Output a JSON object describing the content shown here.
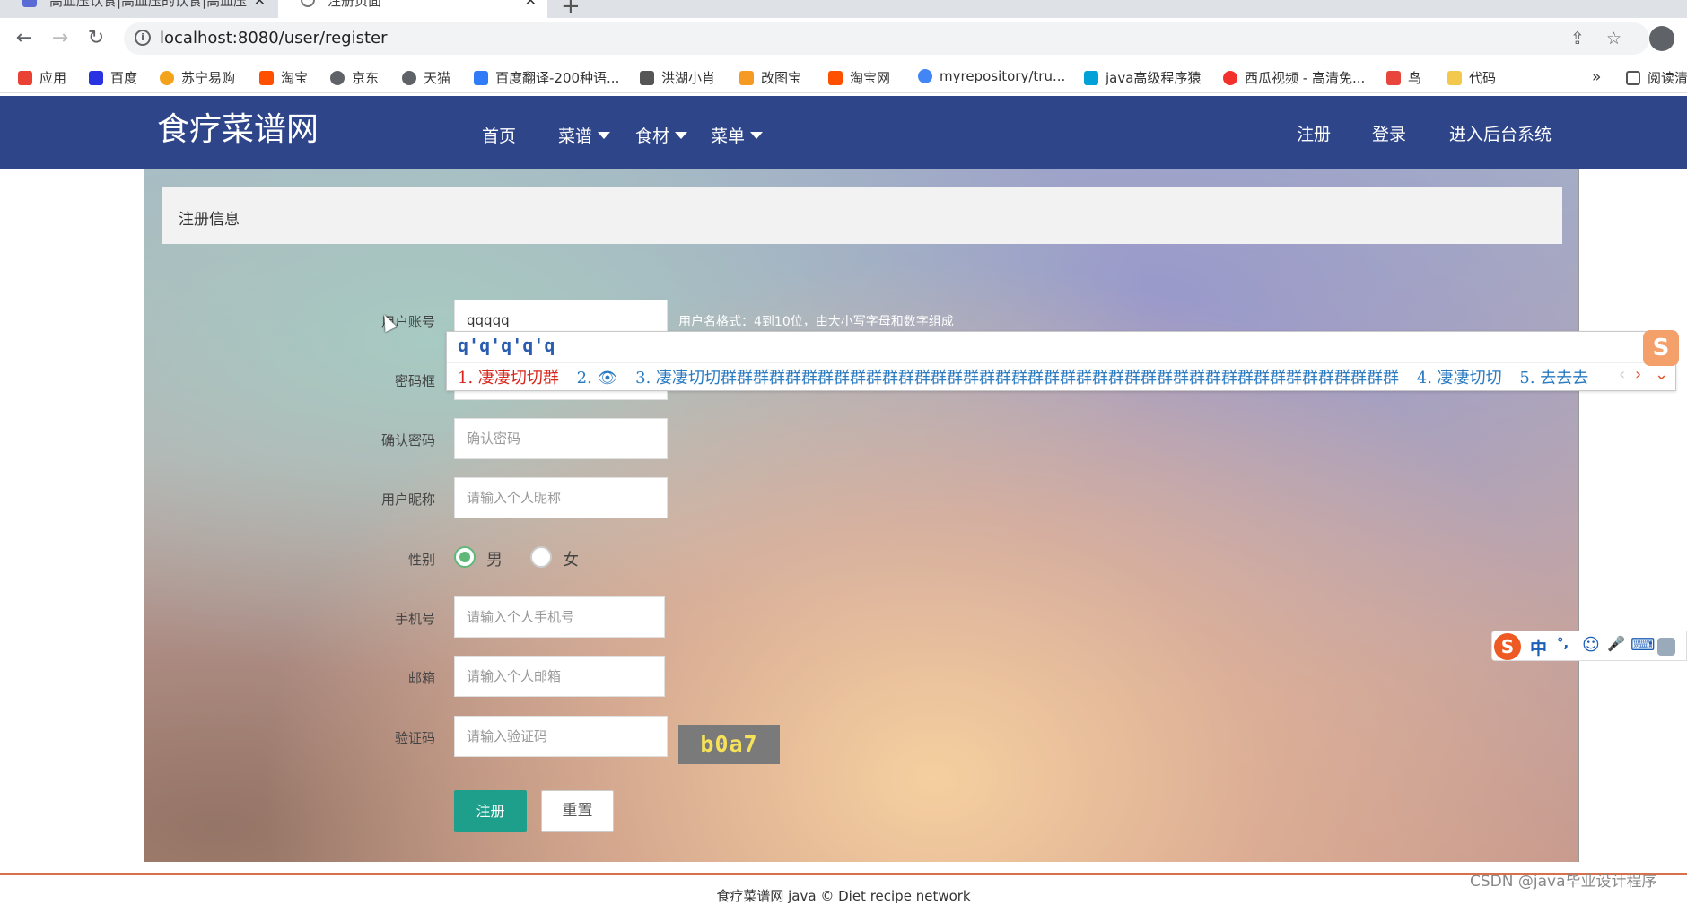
{
  "browser": {
    "tabs": [
      {
        "title": "高血压饮食|高血压的饮食|高血压"
      },
      {
        "title": "注册页面"
      }
    ],
    "url": "localhost:8080/user/register",
    "bookmarks": [
      {
        "label": "应用",
        "color": "#e94235"
      },
      {
        "label": "百度",
        "color": "#2932e1"
      },
      {
        "label": "苏宁易购",
        "color": "#f3a21b"
      },
      {
        "label": "淘宝",
        "color": "#ff5000"
      },
      {
        "label": "京东",
        "color": "#5f6368"
      },
      {
        "label": "天猫",
        "color": "#5f6368"
      },
      {
        "label": "百度翻译-200种语...",
        "color": "#2f7cf6"
      },
      {
        "label": "洪湖小肖",
        "color": "#555555"
      },
      {
        "label": "改图宝",
        "color": "#f59b23"
      },
      {
        "label": "淘宝网",
        "color": "#ff5000"
      },
      {
        "label": "myrepository/tru...",
        "color": "#4285f4"
      },
      {
        "label": "java高级程序猿",
        "color": "#00a1d6"
      },
      {
        "label": "西瓜视频 - 高清免...",
        "color": "#f2312d"
      },
      {
        "label": "鸟",
        "color": "#e8453c"
      },
      {
        "label": "代码",
        "color": "#f2c94c"
      }
    ],
    "bookmarks_more": "»",
    "reading_list": "阅读清"
  },
  "site": {
    "logo": "食疗菜谱网",
    "nav": [
      "首页",
      "菜谱",
      "食材",
      "菜单"
    ],
    "right_nav": [
      "注册",
      "登录",
      "进入后台系统"
    ]
  },
  "form": {
    "panel_title": "注册信息",
    "username": {
      "label": "用户账号",
      "value": "qqqqq",
      "hint": "用户名格式：4到10位，由大小写字母和数字组成"
    },
    "password": {
      "label": "密码框"
    },
    "confirm": {
      "label": "确认密码",
      "placeholder": "确认密码"
    },
    "nickname": {
      "label": "用户昵称",
      "placeholder": "请输入个人昵称"
    },
    "gender": {
      "label": "性别",
      "options": [
        "男",
        "女"
      ],
      "selected": "男"
    },
    "phone": {
      "label": "手机号",
      "placeholder": "请输入个人手机号"
    },
    "email": {
      "label": "邮箱",
      "placeholder": "请输入个人邮箱"
    },
    "captcha": {
      "label": "验证码",
      "placeholder": "请输入验证码",
      "code": "b0a7"
    },
    "submit": "注册",
    "reset": "重置"
  },
  "ime": {
    "composition": "q'q'q'q'q",
    "candidates": [
      "1. 凄凄切切群",
      "2. 👁",
      "3. 凄凄切切群群群群群群群群群群群群群群群群群群群群群群群群群群群群群群群群群群群群群群群群群群",
      "4. 凄凄切切",
      "5. 去去去"
    ],
    "toolbar": [
      "S",
      "中",
      "°,",
      "☺",
      "🎤",
      "⌨"
    ]
  },
  "footer": {
    "text": "食疗菜谱网 java © Diet recipe network",
    "watermark": "CSDN @java毕业设计程序"
  }
}
